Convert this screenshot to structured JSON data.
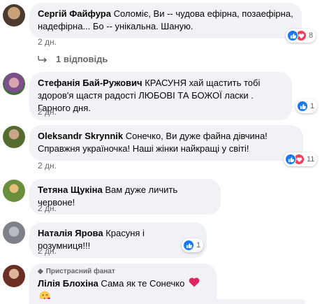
{
  "comments": [
    {
      "author": "Сергій Файфура",
      "text": "Соломіє, Ви -- чудова ефірна, позаефірна, надефірна... Бо -- унікальна. Шаную.",
      "time": "2 дн.",
      "reactions_count": "8",
      "reactions": [
        "like",
        "love"
      ]
    },
    {
      "author": "Стефанія Бай-Ружович",
      "text": "КРАСУНЯ хай щастить тобі здоров'я щастя радості ЛЮБОВІ ТА БОЖОЇ ласки . Гарного дня.",
      "time": "2 дн.",
      "reactions_count": "1",
      "reactions": [
        "like"
      ]
    },
    {
      "author": "Oleksandr Skrynnik",
      "text": "Сонечко, Ви дуже файна дівчина! Справжня україночка! Наші жінки найкращі у світі!",
      "time": "2 дн.",
      "reactions_count": "11",
      "reactions": [
        "like",
        "love"
      ]
    },
    {
      "author": "Тетяна Щукіна",
      "text": "Вам дуже личить червоне!",
      "time": "2 дн."
    },
    {
      "author": "Наталія Ярова",
      "text": "Красуня і розумниця!!!",
      "time": "2 дн.",
      "reactions_count": "1",
      "reactions": [
        "like"
      ]
    },
    {
      "badge": "Пристрасний фанат",
      "author": "Лілія Блохіна",
      "text": "Сама як те Сонечко"
    }
  ],
  "replies_label": "1 відповідь",
  "colors": {
    "bubble": "#f0f2f5",
    "meta": "#65676b",
    "like": "#1877f2",
    "love": "#f33e58"
  }
}
